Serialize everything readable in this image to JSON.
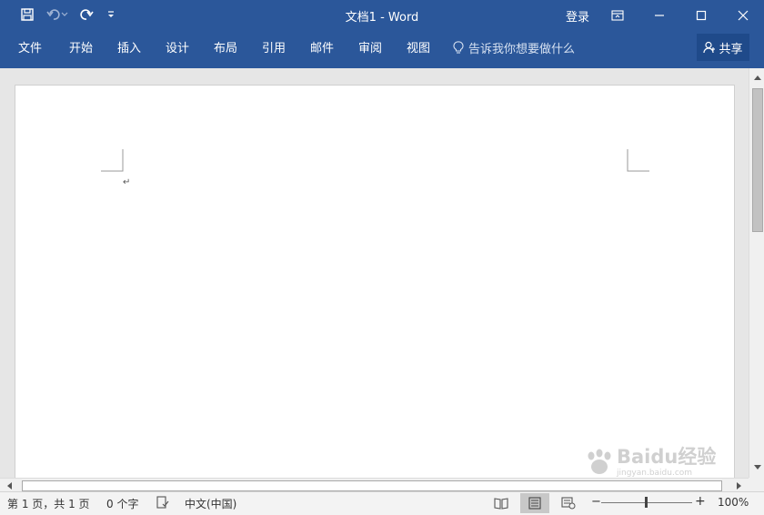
{
  "window": {
    "title": "文档1 - Word",
    "login_label": "登录",
    "accent_color": "#2b579a"
  },
  "qat": {
    "icons": [
      "save-icon",
      "undo-icon",
      "redo-icon",
      "customize-qat-icon"
    ]
  },
  "ribbon": {
    "tabs": [
      {
        "label": "文件"
      },
      {
        "label": "开始"
      },
      {
        "label": "插入"
      },
      {
        "label": "设计"
      },
      {
        "label": "布局"
      },
      {
        "label": "引用"
      },
      {
        "label": "邮件"
      },
      {
        "label": "审阅"
      },
      {
        "label": "视图"
      }
    ],
    "tell_me_placeholder": "告诉我你想要做什么",
    "share_label": "共享"
  },
  "document": {
    "paragraph_mark": "↵"
  },
  "status": {
    "page_info": "第 1 页，共 1 页",
    "word_count": "0 个字",
    "language": "中文(中国)",
    "zoom_level": "100%",
    "zoom_minus": "−",
    "zoom_plus": "+",
    "active_view": "print-layout"
  },
  "watermark": {
    "text": "Baidu经验",
    "sub_text": "jingyan.baidu.com"
  }
}
